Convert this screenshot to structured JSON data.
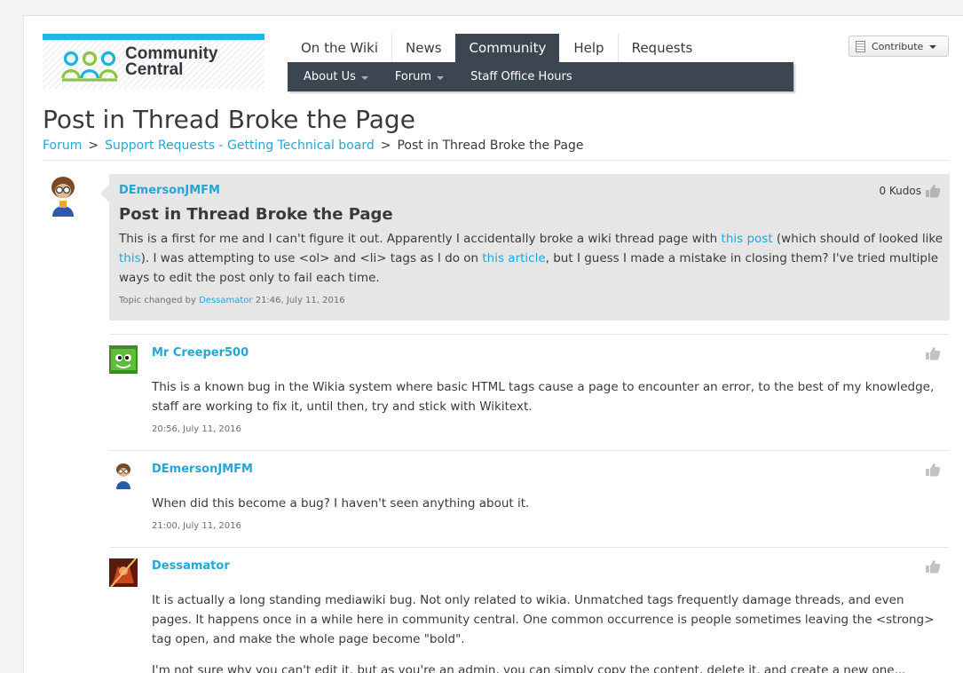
{
  "site": {
    "logo_line1": "Community",
    "logo_line2": "Central",
    "colors": {
      "accent": "#21b6e6",
      "link": "#24a6d6",
      "nav_dark": "#3b4651"
    }
  },
  "topnav": {
    "tabs": [
      {
        "label": "On the Wiki"
      },
      {
        "label": "News"
      },
      {
        "label": "Community",
        "active": true
      },
      {
        "label": "Help"
      },
      {
        "label": "Requests"
      }
    ]
  },
  "subnav": {
    "items": [
      {
        "label": "About Us",
        "dropdown": true
      },
      {
        "label": "Forum",
        "dropdown": true
      },
      {
        "label": "Staff Office Hours",
        "dropdown": false
      }
    ]
  },
  "toolbar": {
    "contribute_label": "Contribute",
    "contribute_icon": "document-icon"
  },
  "page": {
    "title": "Post in Thread Broke the Page"
  },
  "breadcrumb": {
    "items": [
      "Forum",
      "Support Requests - Getting Technical board",
      "Post in Thread Broke the Page"
    ],
    "separator": ">"
  },
  "thread": {
    "author": "DEmersonJMFM",
    "kudos": "0 Kudos",
    "title": "Post in Thread Broke the Page",
    "body": {
      "p1": "This is a first for me and I can't figure it out. Apparently I accidentally broke a wiki thread page with ",
      "link1": "this post",
      "p2": " (which should of looked like ",
      "link2": "this",
      "p3": "). I was attempting to use <ol> and <li> tags as I do on ",
      "link3": "this article",
      "p4": ", but I guess I made a mistake in closing them? I've tried multiple ways to edit the post only to fail each time."
    },
    "meta_prefix": "Topic changed by ",
    "meta_user": "Dessamator",
    "meta_time": " 21:46, July 11, 2016"
  },
  "replies": [
    {
      "author": "Mr Creeper500",
      "body": "This is a known bug in the Wikia system where basic HTML tags cause a page to encounter an error, to the best of my knowledge, staff are working to fix it, until then, try and stick with Wikitext.",
      "time": "20:56, July 11, 2016"
    },
    {
      "author": "DEmersonJMFM",
      "body": "When did this become a bug? I haven't seen anything about it.",
      "time": "21:00, July 11, 2016"
    },
    {
      "author": "Dessamator",
      "body": "It is actually a long standing mediawiki bug. Not only related to wikia. Unmatched tags frequently damage threads, and even pages. It happens once in a while here in community central. One common occurrence is people sometimes leaving the <strong> tag open, and make the whole page become \"bold\".",
      "body2": "I'm not sure why you can't edit it, but as you're an admin, you can simply copy the content, delete it, and create a new one..."
    }
  ]
}
